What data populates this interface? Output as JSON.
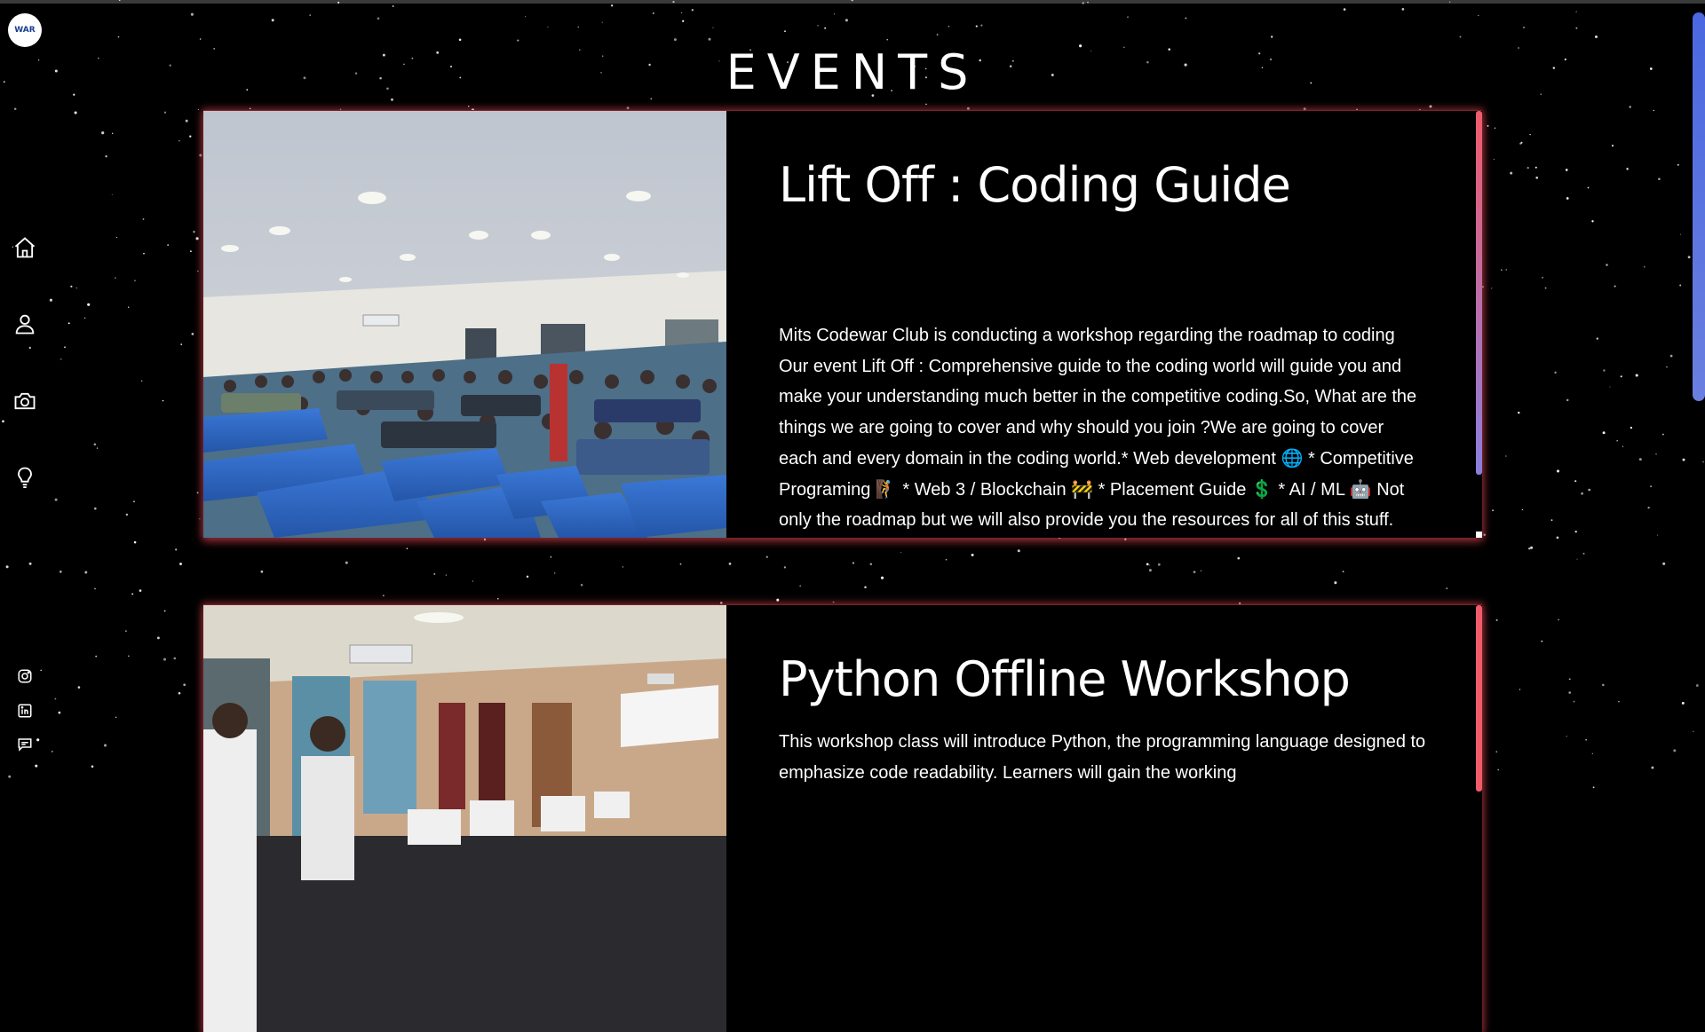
{
  "page": {
    "title": "EVENTS"
  },
  "logo": {
    "text": "WAR"
  },
  "nav": [
    {
      "name": "home-icon"
    },
    {
      "name": "user-icon"
    },
    {
      "name": "camera-icon"
    },
    {
      "name": "lightbulb-icon"
    }
  ],
  "social": [
    {
      "name": "instagram-icon"
    },
    {
      "name": "linkedin-icon"
    },
    {
      "name": "message-icon"
    }
  ],
  "events": [
    {
      "title": "Lift Off : Coding Guide",
      "description": "Mits Codewar Club is conducting a workshop regarding the roadmap to coding Our event Lift Off : Comprehensive guide to the coding world will guide you and make your understanding much better in the competitive coding.So, What are the things we are going to cover and why should you join ?We are going to cover each and every domain in the coding world.* Web development 🌐 * Competitive Programing 🧗 * Web 3 / Blockchain 🚧 * Placement Guide 💲 * AI / ML 🤖 Not only the roadmap but we will also provide you the resources for all of this stuff. Coding discussion with full guidance and link to every resource with flow charts. 👨‍💻 ✅ So what are you all waiting for register fast. 🥳 🥳 and get the knowledge about coding."
    },
    {
      "title": "Python Offline Workshop",
      "description": "This workshop class will introduce Python, the programming language designed to emphasize code readability. Learners will gain the working"
    }
  ],
  "colors": {
    "card_glow": "#dc4650",
    "scroll_thumb": "#5a70e0",
    "background": "#000000"
  }
}
